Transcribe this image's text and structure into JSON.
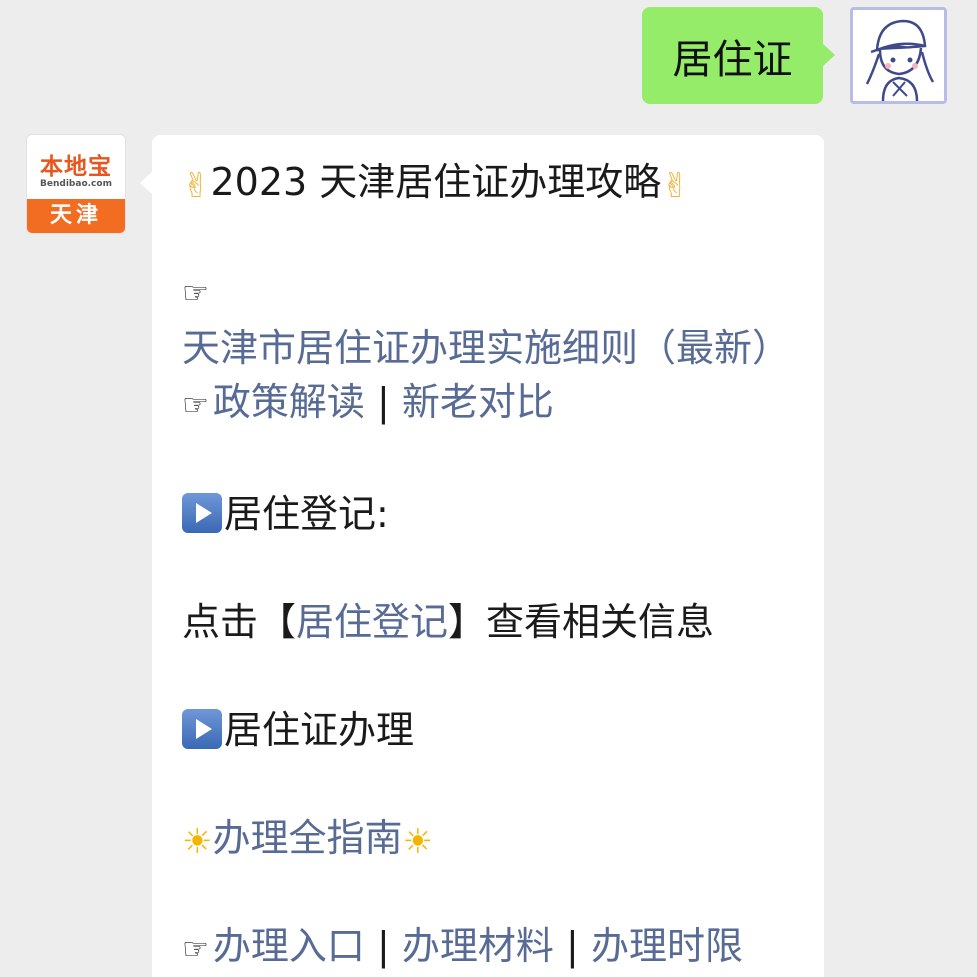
{
  "outgoing": {
    "text": "居住证"
  },
  "incoming": {
    "avatar": {
      "brand": "本地宝",
      "domain": "Bendibao.com",
      "city": "天津"
    },
    "title": "2023 天津居住证办理攻略",
    "links_block1": {
      "implementation_rules": "天津市居住证办理实施细则（最新）",
      "policy_interpretation": "政策解读",
      "separator": "|",
      "old_new_comparison": "新老对比"
    },
    "section_registration": {
      "heading": "居住登记:",
      "prefix": "点击【",
      "link": "居住登记",
      "suffix": "】查看相关信息"
    },
    "section_permit": {
      "heading": "居住证办理",
      "guide_link": "办理全指南",
      "links": {
        "entrance": "办理入口",
        "materials": "办理材料",
        "time_limit": "办理时限"
      }
    }
  },
  "icons": {
    "victory": "victory-hand-emoji",
    "pointer": "pointing-hand-icon",
    "play": "play-button-icon",
    "sun": "sun-emoji"
  },
  "colors": {
    "chat_background": "#ededed",
    "outgoing_bubble": "#95ec69",
    "incoming_bubble": "#ffffff",
    "link": "#576b95",
    "brand_orange": "#f26d21"
  }
}
